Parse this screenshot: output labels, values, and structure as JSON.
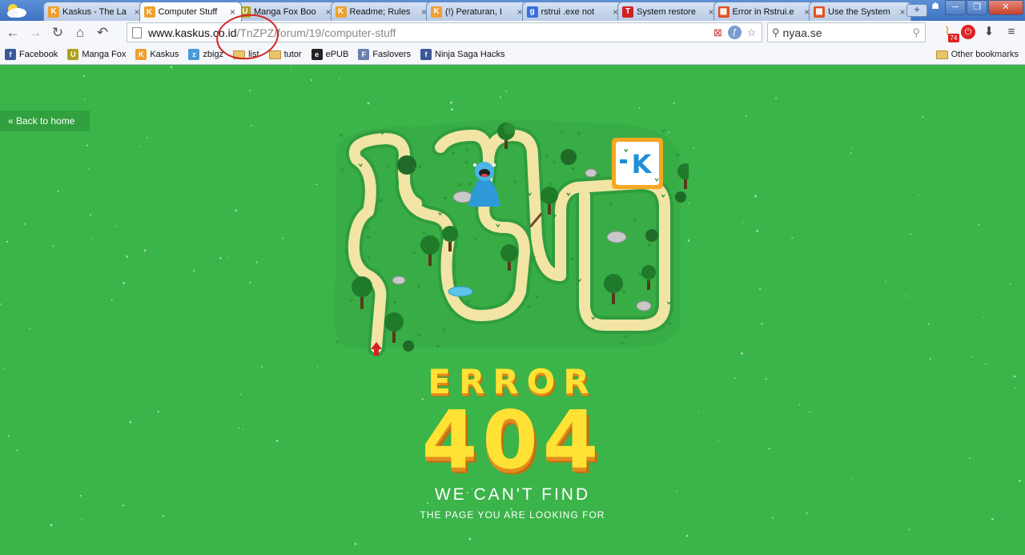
{
  "tabs": [
    {
      "title": "Kaskus - The La",
      "favicon": "kaskus-icon",
      "color": "#f0a030",
      "active": false
    },
    {
      "title": "Computer Stuff",
      "favicon": "kaskus-icon",
      "color": "#f0a030",
      "active": true
    },
    {
      "title": "Manga Fox Boo",
      "favicon": "mangafox-icon",
      "color": "#b0a020",
      "active": false
    },
    {
      "title": "Readme; Rules",
      "favicon": "kaskus-icon",
      "color": "#f0a030",
      "active": false
    },
    {
      "title": "(!) Peraturan, I",
      "favicon": "kaskus-icon",
      "color": "#f0a030",
      "active": false
    },
    {
      "title": "rstrui .exe not",
      "favicon": "google-icon",
      "color": "#3a6fd8",
      "active": false
    },
    {
      "title": "System restore",
      "favicon": "t-icon",
      "color": "#d02020",
      "active": false
    },
    {
      "title": "Error in Rstrui.e",
      "favicon": "windows-icon",
      "color": "#e05020",
      "active": false
    },
    {
      "title": "Use the System",
      "favicon": "windows-icon",
      "color": "#e05020",
      "active": false
    }
  ],
  "toolbar": {
    "url_host": "www.kaskus.co.id",
    "url_path": "/TnZPZ/forum/19/computer-stuff",
    "search_value": "nyaa.se",
    "rss_badge": "74"
  },
  "bookmarks": [
    {
      "label": "Facebook",
      "icon": "facebook-icon",
      "color": "#3b5998",
      "glyph": "f"
    },
    {
      "label": "Manga Fox",
      "icon": "mangafox-icon",
      "color": "#b0a020",
      "glyph": "U"
    },
    {
      "label": "Kaskus",
      "icon": "kaskus-icon",
      "color": "#f0a030",
      "glyph": "K"
    },
    {
      "label": "zbigz",
      "icon": "zbigz-icon",
      "color": "#4a9ad8",
      "glyph": "z"
    },
    {
      "label": "list",
      "icon": "folder-icon",
      "color": "",
      "glyph": ""
    },
    {
      "label": "tutor",
      "icon": "folder-icon",
      "color": "",
      "glyph": ""
    },
    {
      "label": "ePUB",
      "icon": "epub-icon",
      "color": "#222222",
      "glyph": "e"
    },
    {
      "label": "Faslovers",
      "icon": "faslovers-icon",
      "color": "#6a7fb0",
      "glyph": "F"
    },
    {
      "label": "Ninja Saga Hacks",
      "icon": "facebook-icon",
      "color": "#3b5998",
      "glyph": "f"
    }
  ],
  "other_bookmarks": "Other bookmarks",
  "page": {
    "back_link": "« Back to home",
    "error_word": "ERROR",
    "error_code": "404",
    "message_line1": "WE CAN'T FIND",
    "message_line2": "THE PAGE YOU ARE LOOKING FOR",
    "background_color": "#3bb44a",
    "accent_color": "#ffe233",
    "logo_letter": "K"
  }
}
